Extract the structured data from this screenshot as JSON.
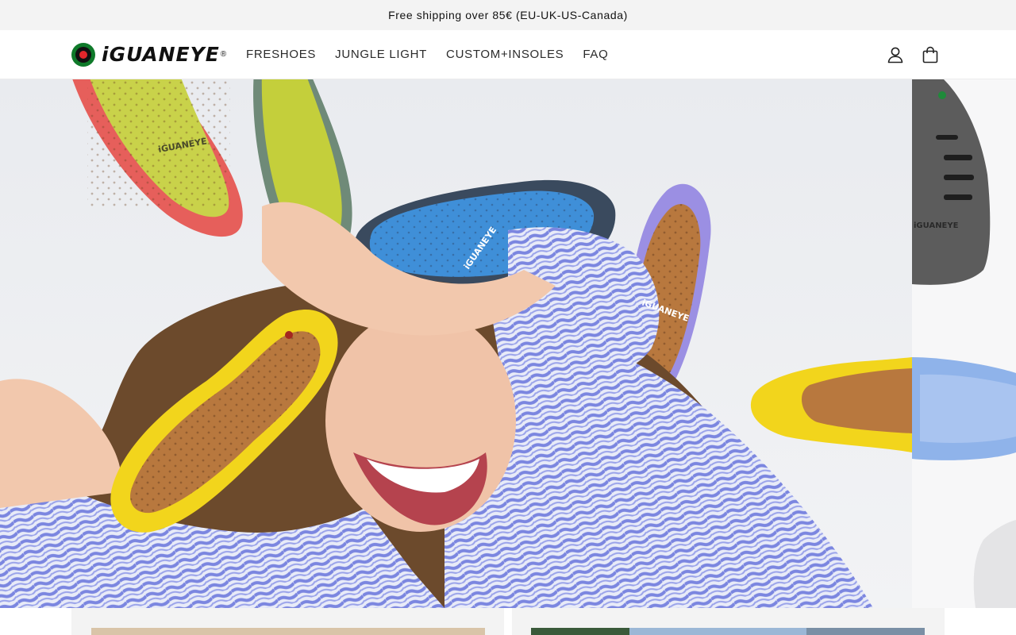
{
  "announcement": {
    "text": "Free shipping over 85€ (EU-UK-US-Canada)"
  },
  "header": {
    "logo_text": "iGUANEYE",
    "logo_reg": "®",
    "nav": [
      {
        "label": "FRESHOES"
      },
      {
        "label": "JUNGLE LIGHT"
      },
      {
        "label": "CUSTOM+INSOLES"
      },
      {
        "label": "FAQ"
      }
    ],
    "account_icon": "user-icon",
    "cart_icon": "bag-icon"
  },
  "hero": {
    "main_slide_image": "woman-with-colorful-insoles",
    "insole_brand_print": "iGUANEYE",
    "next_slide_image": "grey-shoe-and-blue-insole"
  },
  "brand_colors": {
    "green": "#0f7a2a",
    "red": "#e3262b",
    "black": "#111111"
  }
}
